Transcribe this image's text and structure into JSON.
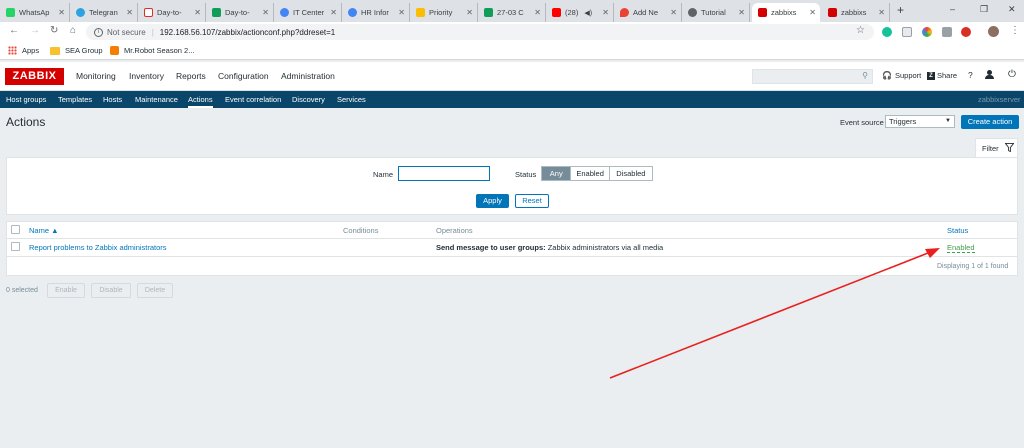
{
  "browser": {
    "tabs": [
      {
        "label": "WhatsAp",
        "color": "#25d366"
      },
      {
        "label": "Telegran",
        "color": "#2aa3e0"
      },
      {
        "label": "Day-to-",
        "color": "#d93025"
      },
      {
        "label": "Day-to-",
        "color": "#0f9d58"
      },
      {
        "label": "IT Center",
        "color": "#4285f4"
      },
      {
        "label": "HR Infor",
        "color": "#4285f4"
      },
      {
        "label": "Priority",
        "color": "#fbbc04"
      },
      {
        "label": "27-03 C",
        "color": "#0f9d58"
      },
      {
        "label": "(28)",
        "color": "#ff0000"
      },
      {
        "label": "Add Ne",
        "color": "#ea4335"
      },
      {
        "label": "Tutorial",
        "color": "#5f6368"
      },
      {
        "label": "zabbixs",
        "color": "#d40000"
      },
      {
        "label": "zabbixs",
        "color": "#d40000"
      }
    ],
    "new_tab": "+",
    "window_controls": {
      "minimize": "–",
      "restore": "❐",
      "close": "✕"
    },
    "nav": {
      "back": "←",
      "forward": "→",
      "reload": "↻"
    },
    "security_label": "Not secure",
    "url": "192.168.56.107/zabbix/actionconf.php?ddreset=1",
    "bookmarks": [
      {
        "label": "Apps",
        "icon": "apps-grid-icon"
      },
      {
        "label": "SEA Group",
        "icon": "folder-icon"
      },
      {
        "label": "Mr.Robot Season 2...",
        "icon": "blogger-icon"
      }
    ]
  },
  "zabbix": {
    "logo": "ZABBIX",
    "menu": [
      "Monitoring",
      "Inventory",
      "Reports",
      "Configuration",
      "Administration"
    ],
    "header_links": {
      "support": "Support",
      "share": "Share",
      "help": "?"
    },
    "submenu": [
      "Host groups",
      "Templates",
      "Hosts",
      "Maintenance",
      "Actions",
      "Event correlation",
      "Discovery",
      "Services"
    ],
    "server_name": "zabbixserver",
    "page_title": "Actions",
    "event_source_label": "Event source",
    "event_source_value": "Triggers",
    "create_button": "Create action",
    "filter": {
      "tab_label": "Filter",
      "name_label": "Name",
      "name_value": "",
      "status_label": "Status",
      "status_options": [
        "Any",
        "Enabled",
        "Disabled"
      ],
      "selected_status": "Any",
      "apply": "Apply",
      "reset": "Reset"
    },
    "table": {
      "headers": {
        "name": "Name ▲",
        "conditions": "Conditions",
        "operations": "Operations",
        "status": "Status"
      },
      "rows": [
        {
          "name": "Report problems to Zabbix administrators",
          "conditions": "",
          "operation_bold": "Send message to user groups:",
          "operation_text": " Zabbix administrators via all media",
          "status": "Enabled"
        }
      ],
      "footer": "Displaying 1 of 1 found"
    },
    "mass": {
      "selected": "0 selected",
      "buttons": [
        "Enable",
        "Disable",
        "Delete"
      ]
    }
  },
  "annotation": {
    "color": "#e8201e"
  }
}
